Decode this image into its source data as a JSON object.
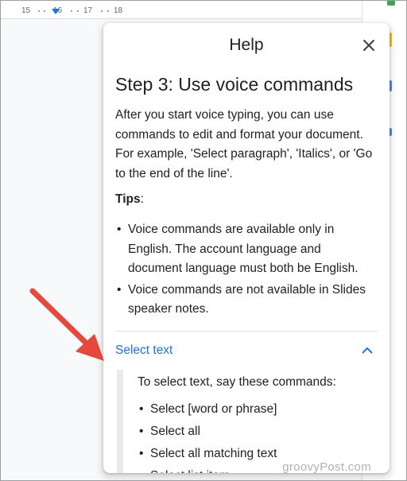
{
  "ruler": {
    "ticks": [
      "15",
      "16",
      "17",
      "18"
    ]
  },
  "help_panel": {
    "title": "Help",
    "close_icon": "close-icon",
    "step_title": "Step 3: Use voice commands",
    "intro": "After you start voice typing, you can use commands to edit and format your document. For example, 'Select paragraph', 'Italics', or 'Go to the end of the line'.",
    "tips_label": "Tips",
    "tips_suffix": ":",
    "tips": [
      "Voice commands are available only in English. The account language and document language must both be English.",
      "Voice commands are not available in Slides speaker notes."
    ],
    "section": {
      "label": "Select text",
      "state_icon": "chevron-up-icon",
      "intro": "To select text, say these commands:",
      "commands": [
        "Select [word or phrase]",
        "Select all",
        "Select all matching text",
        "Select list item"
      ]
    }
  },
  "watermark": "groovyPost.com",
  "colors": {
    "accent": "#1a73e8",
    "arrow": "#e8473b"
  }
}
